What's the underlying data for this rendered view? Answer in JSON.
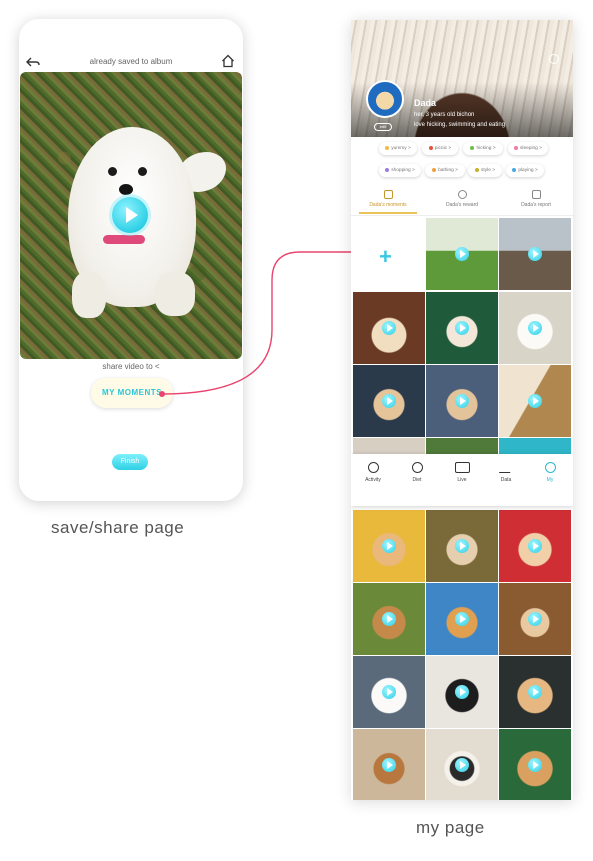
{
  "left_screen": {
    "title": "already saved to album",
    "share_text": "share video to",
    "moment_button": "MY MOMENTS",
    "finish_button": "Finish",
    "caption": "save/share page"
  },
  "right_screen": {
    "profile": {
      "name": "Dada",
      "bio_line1": "her, 3 years old bichon",
      "bio_line2": "love hicking, swimming and eating",
      "edit_label": "edit"
    },
    "tags": [
      {
        "label": "yummy >",
        "color": "#f2b84b"
      },
      {
        "label": "picnic >",
        "color": "#e0553a"
      },
      {
        "label": "hicking >",
        "color": "#6fbf4a"
      },
      {
        "label": "sleeping >",
        "color": "#f07aa0"
      },
      {
        "label": "shopping >",
        "color": "#9b7be0"
      },
      {
        "label": "bathing >",
        "color": "#f0a040"
      },
      {
        "label": "style >",
        "color": "#c7b02a"
      },
      {
        "label": "playing >",
        "color": "#4aa8e0"
      }
    ],
    "tabs": [
      {
        "label": "Dada's moments",
        "icon": "moments-icon",
        "active": true
      },
      {
        "label": "Dada's reward",
        "icon": "trophy-icon",
        "active": false
      },
      {
        "label": "Dada's report",
        "icon": "report-icon",
        "active": false
      }
    ],
    "nav": [
      {
        "label": "Activity",
        "icon": "search-icon",
        "active": false
      },
      {
        "label": "Diet",
        "icon": "clock-icon",
        "active": false
      },
      {
        "label": "Live",
        "icon": "video-camera-icon",
        "active": false
      },
      {
        "label": "Data",
        "icon": "chart-icon",
        "active": false
      },
      {
        "label": "My",
        "icon": "user-icon",
        "active": true
      }
    ],
    "caption": "my page"
  }
}
